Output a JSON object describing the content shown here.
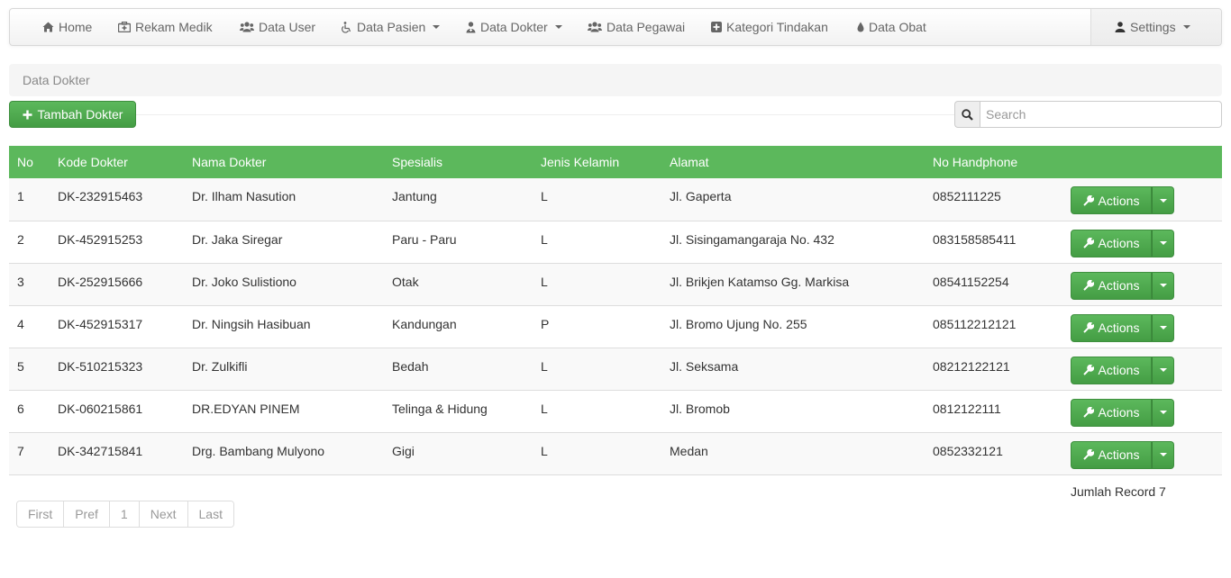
{
  "nav": {
    "home": "Home",
    "rekam_medik": "Rekam Medik",
    "data_user": "Data User",
    "data_pasien": "Data Pasien",
    "data_dokter": "Data Dokter",
    "data_pegawai": "Data Pegawai",
    "kategori_tindakan": "Kategori Tindakan",
    "data_obat": "Data Obat",
    "settings": "Settings"
  },
  "breadcrumb": "Data Dokter",
  "toolbar": {
    "add_label": "Tambah Dokter",
    "search_placeholder": "Search"
  },
  "table": {
    "headers": [
      "No",
      "Kode Dokter",
      "Nama Dokter",
      "Spesialis",
      "Jenis Kelamin",
      "Alamat",
      "No Handphone",
      ""
    ],
    "rows": [
      {
        "no": "1",
        "kode": "DK-232915463",
        "nama": "Dr. Ilham Nasution",
        "spesialis": "Jantung",
        "jk": "L",
        "alamat": "Jl. Gaperta",
        "hp": "0852111225",
        "action": "Actions"
      },
      {
        "no": "2",
        "kode": "DK-452915253",
        "nama": "Dr. Jaka Siregar",
        "spesialis": "Paru - Paru",
        "jk": "L",
        "alamat": "Jl. Sisingamangaraja No. 432",
        "hp": "083158585411",
        "action": "Actions"
      },
      {
        "no": "3",
        "kode": "DK-252915666",
        "nama": "Dr. Joko Sulistiono",
        "spesialis": "Otak",
        "jk": "L",
        "alamat": "Jl. Brikjen Katamso Gg. Markisa",
        "hp": "08541152254",
        "action": "Actions"
      },
      {
        "no": "4",
        "kode": "DK-452915317",
        "nama": "Dr. Ningsih Hasibuan",
        "spesialis": "Kandungan",
        "jk": "P",
        "alamat": "Jl. Bromo Ujung No. 255",
        "hp": "085112212121",
        "action": "Actions"
      },
      {
        "no": "5",
        "kode": "DK-510215323",
        "nama": "Dr. Zulkifli",
        "spesialis": "Bedah",
        "jk": "L",
        "alamat": "Jl. Seksama",
        "hp": "08212122121",
        "action": "Actions"
      },
      {
        "no": "6",
        "kode": "DK-060215861",
        "nama": "DR.EDYAN PINEM",
        "spesialis": "Telinga & Hidung",
        "jk": "L",
        "alamat": "Jl. Bromob",
        "hp": "0812122111",
        "action": "Actions"
      },
      {
        "no": "7",
        "kode": "DK-342715841",
        "nama": "Drg. Bambang Mulyono",
        "spesialis": "Gigi",
        "jk": "L",
        "alamat": "Medan",
        "hp": "0852332121",
        "action": "Actions"
      }
    ]
  },
  "record_count": "Jumlah Record 7",
  "pagination": [
    "First",
    "Pref",
    "1",
    "Next",
    "Last"
  ],
  "colors": {
    "accent": "#5cb85c",
    "accent_dark": "#449d44",
    "nav_text": "#666666"
  },
  "icons": {
    "home": "home-icon",
    "rekam_medik": "medkit-icon",
    "data_user": "users-icon",
    "data_pasien": "wheelchair-icon",
    "data_dokter": "user-md-icon",
    "data_pegawai": "users-icon",
    "kategori_tindakan": "plus-square-icon",
    "data_obat": "tint-icon",
    "settings": "user-icon",
    "add": "plus-icon",
    "search": "search-icon",
    "actions": "wrench-icon"
  }
}
